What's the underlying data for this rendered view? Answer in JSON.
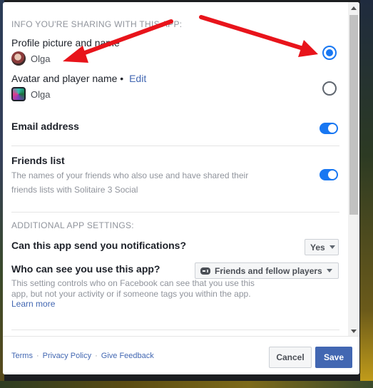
{
  "sharing_section": {
    "header": "INFO YOU'RE SHARING WITH THIS APP:",
    "profile_option": {
      "title": "Profile picture and name",
      "name": "Olga",
      "selected": true
    },
    "avatar_option": {
      "title": "Avatar and player name",
      "bullet": "•",
      "edit_label": "Edit",
      "name": "Olga",
      "selected": false
    },
    "email": {
      "title": "Email address",
      "enabled": true
    },
    "friends": {
      "title": "Friends list",
      "description": "The names of your friends who also use and have shared their friends lists with Solitaire 3 Social",
      "enabled": true
    }
  },
  "additional_section": {
    "header": "ADDITIONAL APP SETTINGS:",
    "notifications": {
      "question": "Can this app send you notifications?",
      "value": "Yes"
    },
    "visibility": {
      "question": "Who can see you use this app?",
      "value": "Friends and fellow players",
      "description": "This setting controls who on Facebook can see that you use this app, but not your activity or if someone tags you within the app.",
      "learn_more": "Learn more"
    }
  },
  "footer": {
    "links": [
      "Terms",
      "Privacy Policy",
      "Give Feedback"
    ],
    "separator": "·",
    "cancel_label": "Cancel",
    "save_label": "Save"
  },
  "colors": {
    "accent": "#1877f2",
    "link": "#4267b2",
    "save_button": "#4267b2",
    "annotation_arrow": "#e8141b"
  },
  "icons": {
    "visibility_select": "gamepad-icon",
    "select_caret": "chevron-down-icon"
  }
}
